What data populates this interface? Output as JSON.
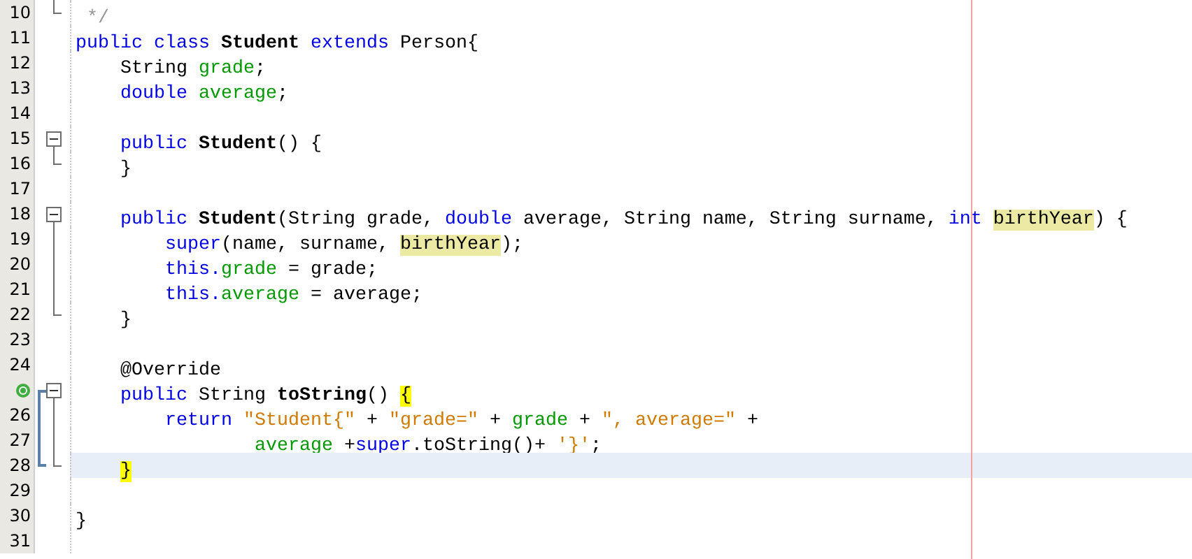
{
  "editor": {
    "lines": [
      {
        "number": "10",
        "fold": {
          "kind": "end"
        },
        "current": false,
        "tokens": [
          {
            "text": " */",
            "kind": "comment"
          }
        ]
      },
      {
        "number": "11",
        "current": false,
        "tokens": [
          {
            "text": "public class ",
            "kind": "keyword"
          },
          {
            "text": "Student",
            "kind": "declaration"
          },
          {
            "text": " extends",
            "kind": "keyword"
          },
          {
            "text": " Person{",
            "kind": "plain"
          }
        ]
      },
      {
        "number": "12",
        "current": false,
        "tokens": [
          {
            "text": "    String ",
            "kind": "plain"
          },
          {
            "text": "grade",
            "kind": "field"
          },
          {
            "text": ";",
            "kind": "plain"
          }
        ]
      },
      {
        "number": "13",
        "current": false,
        "tokens": [
          {
            "text": "    double ",
            "kind": "keyword"
          },
          {
            "text": "average",
            "kind": "field"
          },
          {
            "text": ";",
            "kind": "plain"
          }
        ]
      },
      {
        "number": "14",
        "current": false
      },
      {
        "number": "15",
        "fold": {
          "kind": "start"
        },
        "current": false,
        "tokens": [
          {
            "text": "    public ",
            "kind": "keyword"
          },
          {
            "text": "Student",
            "kind": "declaration"
          },
          {
            "text": "() {",
            "kind": "plain"
          }
        ]
      },
      {
        "number": "16",
        "fold": {
          "kind": "end"
        },
        "current": false,
        "tokens": [
          {
            "text": "    }",
            "kind": "plain"
          }
        ]
      },
      {
        "number": "17",
        "current": false
      },
      {
        "number": "18",
        "fold": {
          "kind": "start"
        },
        "current": false,
        "tokens": [
          {
            "text": "    public ",
            "kind": "keyword"
          },
          {
            "text": "Student",
            "kind": "declaration"
          },
          {
            "text": "(String grade, ",
            "kind": "plain"
          },
          {
            "text": "double",
            "kind": "keyword"
          },
          {
            "text": " average, String name, String surname, ",
            "kind": "plain"
          },
          {
            "text": "int ",
            "kind": "keyword"
          },
          {
            "text": "birthYear",
            "kind": "occurrence"
          },
          {
            "text": ") {",
            "kind": "plain"
          }
        ]
      },
      {
        "number": "19",
        "fold": {
          "kind": "middle"
        },
        "current": false,
        "tokens": [
          {
            "text": "        super",
            "kind": "keyword"
          },
          {
            "text": "(name, surname, ",
            "kind": "plain"
          },
          {
            "text": "birthYear",
            "kind": "occurrence"
          },
          {
            "text": ");",
            "kind": "plain"
          }
        ]
      },
      {
        "number": "20",
        "fold": {
          "kind": "middle"
        },
        "current": false,
        "tokens": [
          {
            "text": "        this.",
            "kind": "keyword"
          },
          {
            "text": "grade",
            "kind": "field"
          },
          {
            "text": " = grade;",
            "kind": "plain"
          }
        ]
      },
      {
        "number": "21",
        "fold": {
          "kind": "middle"
        },
        "current": false,
        "tokens": [
          {
            "text": "        this.",
            "kind": "keyword"
          },
          {
            "text": "average",
            "kind": "field"
          },
          {
            "text": " = average;",
            "kind": "plain"
          }
        ]
      },
      {
        "number": "22",
        "fold": {
          "kind": "end"
        },
        "current": false,
        "tokens": [
          {
            "text": "    }",
            "kind": "plain"
          }
        ]
      },
      {
        "number": "23",
        "current": false
      },
      {
        "number": "24",
        "current": false,
        "tokens": [
          {
            "text": "    @Override",
            "kind": "plain"
          }
        ]
      },
      {
        "marker": {
          "kind": "override"
        },
        "fold": {
          "kind": "start"
        },
        "current": false,
        "tokens": [
          {
            "text": "    public ",
            "kind": "keyword"
          },
          {
            "text": "String ",
            "kind": "plain"
          },
          {
            "text": "toString",
            "kind": "declaration"
          },
          {
            "text": "() ",
            "kind": "plain"
          },
          {
            "text": "{",
            "kind": "brace"
          }
        ]
      },
      {
        "number": "26",
        "fold": {
          "kind": "middle"
        },
        "current": false,
        "tokens": [
          {
            "text": "        return ",
            "kind": "keyword"
          },
          {
            "text": "\"Student{\"",
            "kind": "string"
          },
          {
            "text": " + ",
            "kind": "plain"
          },
          {
            "text": "\"grade=\"",
            "kind": "string"
          },
          {
            "text": " + ",
            "kind": "plain"
          },
          {
            "text": "grade",
            "kind": "field"
          },
          {
            "text": " + ",
            "kind": "plain"
          },
          {
            "text": "\", average=\"",
            "kind": "string"
          },
          {
            "text": " +",
            "kind": "plain"
          }
        ]
      },
      {
        "number": "27",
        "fold": {
          "kind": "middle"
        },
        "current": false,
        "tokens": [
          {
            "text": "                average",
            "kind": "field"
          },
          {
            "text": " +",
            "kind": "plain"
          },
          {
            "text": "super",
            "kind": "keyword"
          },
          {
            "text": ".toString()+ ",
            "kind": "plain"
          },
          {
            "text": "'}'",
            "kind": "string"
          },
          {
            "text": ";",
            "kind": "plain"
          }
        ]
      },
      {
        "number": "28",
        "fold": {
          "kind": "end"
        },
        "current": true,
        "tokens": [
          {
            "text": "    }",
            "kind": "brace"
          }
        ]
      },
      {
        "number": "29",
        "current": false
      },
      {
        "number": "30",
        "current": false,
        "tokens": [
          {
            "text": "}",
            "kind": "plain"
          }
        ]
      },
      {
        "number": "31",
        "current": false
      }
    ]
  }
}
